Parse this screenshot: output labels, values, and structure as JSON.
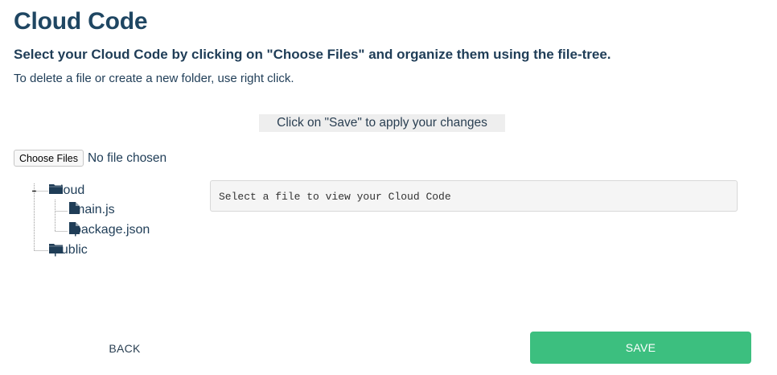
{
  "page": {
    "title": "Cloud Code",
    "subtitle": "Select your Cloud Code by clicking on \"Choose Files\" and organize them using the file-tree.",
    "hint": "To delete a file or create a new folder, use right click.",
    "notice": "Click on \"Save\" to apply your changes"
  },
  "file_input": {
    "button_label": "Choose Files",
    "status": "No file chosen"
  },
  "tree": {
    "folder_cloud": "cloud",
    "file_main": "main.js",
    "file_package": "package.json",
    "folder_public": "public"
  },
  "viewer": {
    "placeholder": "Select a file to view your Cloud Code"
  },
  "actions": {
    "back_label": "BACK",
    "save_label": "SAVE"
  },
  "colors": {
    "save_button": "#3cbf7f",
    "heading": "#1f4662",
    "icon": "#1f3d57"
  }
}
